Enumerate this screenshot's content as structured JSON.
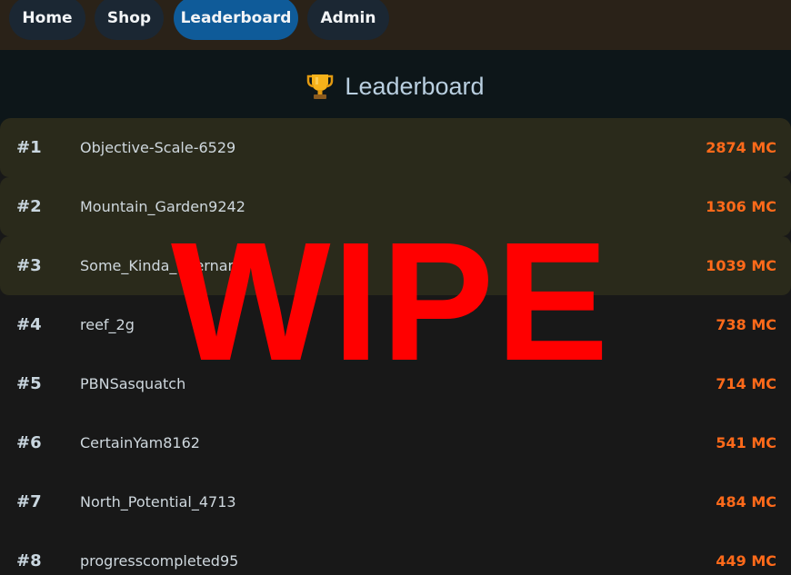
{
  "nav": {
    "items": [
      {
        "label": "Home",
        "active": false
      },
      {
        "label": "Shop",
        "active": false
      },
      {
        "label": "Leaderboard",
        "active": true
      },
      {
        "label": "Admin",
        "active": false
      }
    ]
  },
  "header": {
    "icon": "trophy-icon",
    "title": "Leaderboard"
  },
  "leaderboard": {
    "rows": [
      {
        "rank": "#1",
        "name": "Objective-Scale-6529",
        "score": "2874 MC"
      },
      {
        "rank": "#2",
        "name": "Mountain_Garden9242",
        "score": "1306 MC"
      },
      {
        "rank": "#3",
        "name": "Some_Kinda_Username",
        "score": "1039 MC"
      },
      {
        "rank": "#4",
        "name": "reef_2g",
        "score": "738 MC"
      },
      {
        "rank": "#5",
        "name": "PBNSasquatch",
        "score": "714 MC"
      },
      {
        "rank": "#6",
        "name": "CertainYam8162",
        "score": "541 MC"
      },
      {
        "rank": "#7",
        "name": "North_Potential_4713",
        "score": "484 MC"
      },
      {
        "rank": "#8",
        "name": "progresscompleted95",
        "score": "449 MC"
      }
    ]
  },
  "overlay": {
    "text": "WIPE"
  },
  "colors": {
    "nav_bg": "#2a2218",
    "nav_button": "#1b2733",
    "nav_button_active": "#0f5b99",
    "top3_row": "#2a2a1b",
    "score": "#ff6a1a",
    "overlay": "#ff0000"
  }
}
